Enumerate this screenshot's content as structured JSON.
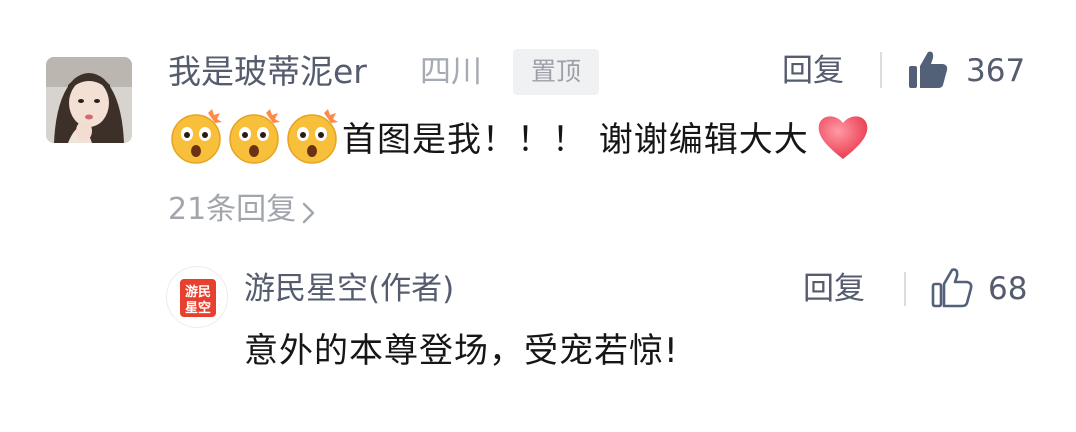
{
  "comment": {
    "username": "我是玻蒂泥er",
    "location": "四川",
    "pinned_label": "置顶",
    "reply_label": "回复",
    "like_count": "367",
    "text": "首图是我！！！ 谢谢编辑大大",
    "emojis": [
      "shocked-emoji",
      "shocked-emoji",
      "shocked-emoji",
      "heart-emoji"
    ],
    "reply_count_text": "21条回复",
    "colors": {
      "name": "#555c6e",
      "meta": "#a6abb3",
      "text": "#161616"
    }
  },
  "author_reply": {
    "name": "游民星空(作者)",
    "avatar_text": [
      "游民",
      "星空"
    ],
    "avatar_color": "#e8402e",
    "reply_label": "回复",
    "like_count": "68",
    "text": "意外的本尊登场，受宠若惊!"
  }
}
